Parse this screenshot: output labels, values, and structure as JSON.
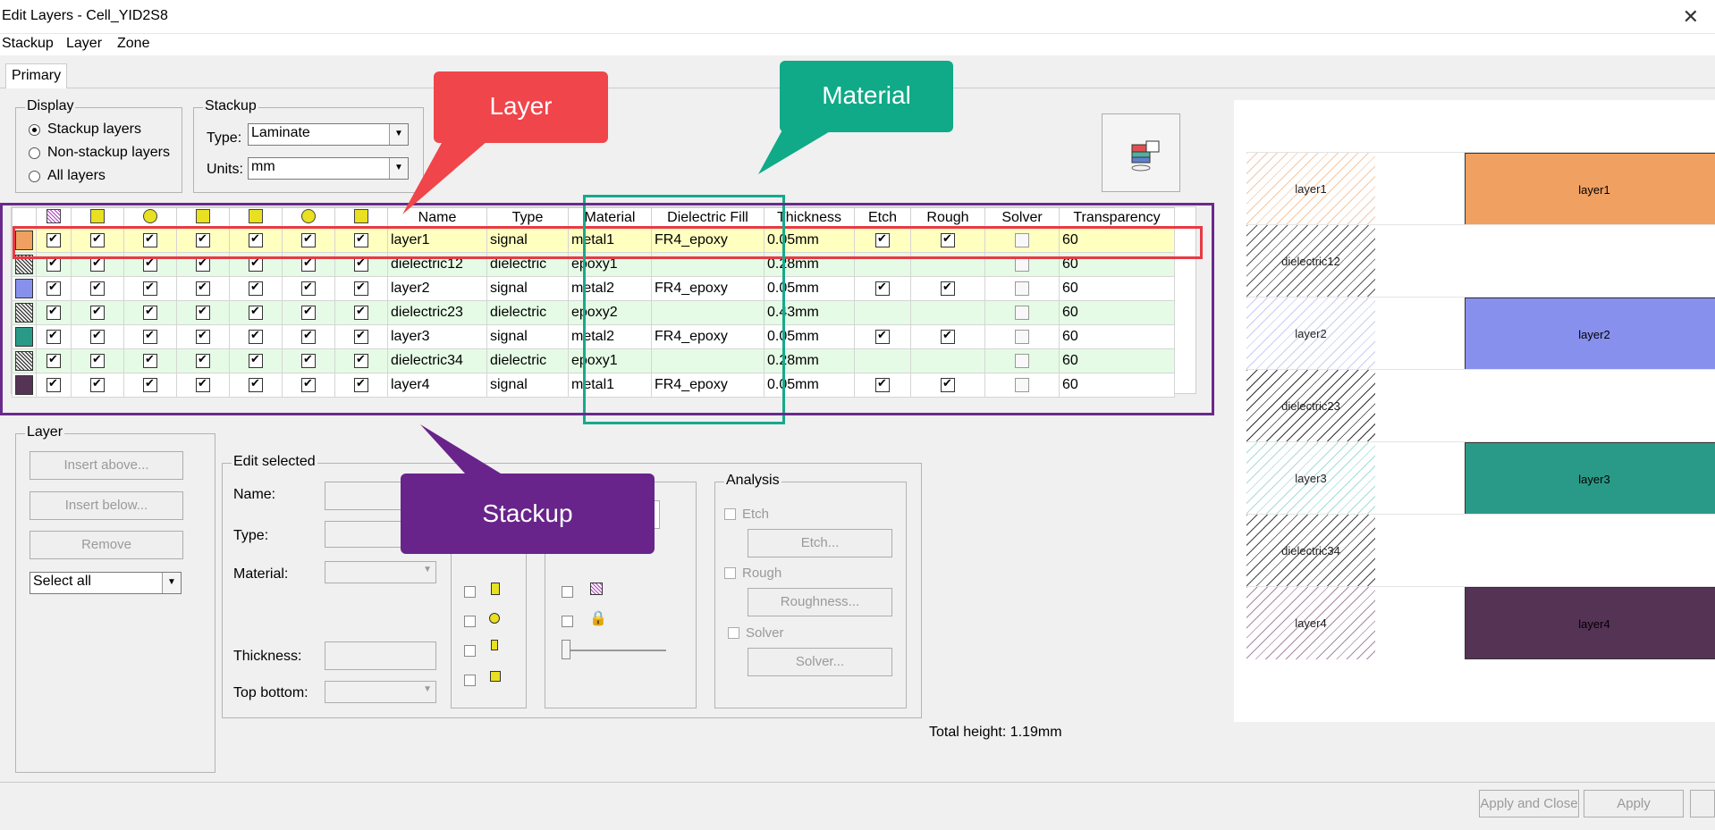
{
  "window": {
    "title": "Edit Layers - Cell_YID2S8",
    "close_icon": "close-icon"
  },
  "menu": [
    "Stackup",
    "Layer",
    "Zone"
  ],
  "tabs": [
    {
      "label": "Primary"
    }
  ],
  "display": {
    "legend": "Display",
    "options": [
      "Stackup layers",
      "Non-stackup layers",
      "All layers"
    ],
    "selected": "Stackup layers"
  },
  "stackup_group": {
    "legend": "Stackup",
    "type_label": "Type:",
    "type_value": "Laminate",
    "units_label": "Units:",
    "units_value": "mm"
  },
  "grid": {
    "columns": [
      "Name",
      "Type",
      "Material",
      "Dielectric Fill",
      "Thickness",
      "Etch",
      "Rough",
      "Solver",
      "Transparency"
    ],
    "icon_columns": [
      "layer-pattern-icon",
      "via-icon",
      "trace-icon",
      "component-icon",
      "pad-icon",
      "connector-icon",
      "antenna-icon"
    ],
    "rows": [
      {
        "name": "layer1",
        "type": "signal",
        "material": "metal1",
        "fill": "FR4_epoxy",
        "thickness": "0.05mm",
        "etch": true,
        "rough": true,
        "solver": false,
        "transparency": "60",
        "color": "#f0a060",
        "hatch": false
      },
      {
        "name": "dielectric12",
        "type": "dielectric",
        "material": "epoxy1",
        "fill": "",
        "thickness": "0.28mm",
        "etch": null,
        "rough": null,
        "solver": false,
        "transparency": "60",
        "color": "#7a8a70",
        "hatch": true
      },
      {
        "name": "layer2",
        "type": "signal",
        "material": "metal2",
        "fill": "FR4_epoxy",
        "thickness": "0.05mm",
        "etch": true,
        "rough": true,
        "solver": false,
        "transparency": "60",
        "color": "#8890ee",
        "hatch": false
      },
      {
        "name": "dielectric23",
        "type": "dielectric",
        "material": "epoxy2",
        "fill": "",
        "thickness": "0.43mm",
        "etch": null,
        "rough": null,
        "solver": false,
        "transparency": "60",
        "color": "#333333",
        "hatch": true
      },
      {
        "name": "layer3",
        "type": "signal",
        "material": "metal2",
        "fill": "FR4_epoxy",
        "thickness": "0.05mm",
        "etch": true,
        "rough": true,
        "solver": false,
        "transparency": "60",
        "color": "#2a9a88",
        "hatch": false
      },
      {
        "name": "dielectric34",
        "type": "dielectric",
        "material": "epoxy1",
        "fill": "",
        "thickness": "0.28mm",
        "etch": null,
        "rough": null,
        "solver": false,
        "transparency": "60",
        "color": "#6a9070",
        "hatch": true
      },
      {
        "name": "layer4",
        "type": "signal",
        "material": "metal1",
        "fill": "FR4_epoxy",
        "thickness": "0.05mm",
        "etch": true,
        "rough": true,
        "solver": false,
        "transparency": "60",
        "color": "#553355",
        "hatch": false
      }
    ]
  },
  "layer_group": {
    "legend": "Layer",
    "insert_above": "Insert above...",
    "insert_below": "Insert below...",
    "remove": "Remove",
    "select": "Select all"
  },
  "edit_selected": {
    "legend": "Edit selected",
    "name_label": "Name:",
    "type_label": "Type:",
    "material_label": "Material:",
    "thickness_label": "Thickness:",
    "topbottom_label": "Top bottom:"
  },
  "analysis": {
    "legend": "Analysis",
    "etch": "Etch",
    "etch_btn": "Etch...",
    "rough": "Rough",
    "rough_btn": "Roughness...",
    "solver": "Solver",
    "solver_btn": "Solver..."
  },
  "total_height": "Total height: 1.19mm",
  "footer": {
    "apply_close": "Apply and Close",
    "apply": "Apply"
  },
  "preview": {
    "rows": [
      {
        "label": "layer1",
        "bar": true,
        "color": "#f0a060",
        "hatch_color": "#f3c8a8"
      },
      {
        "label": "dielectric12",
        "bar": false,
        "hatch_color": "#555555"
      },
      {
        "label": "layer2",
        "bar": true,
        "color": "#8890ee",
        "hatch_color": "#c8ccf4"
      },
      {
        "label": "dielectric23",
        "bar": false,
        "hatch_color": "#333333"
      },
      {
        "label": "layer3",
        "bar": true,
        "color": "#2a9a88",
        "hatch_color": "#a8dcd4"
      },
      {
        "label": "dielectric34",
        "bar": false,
        "hatch_color": "#444444"
      },
      {
        "label": "layer4",
        "bar": true,
        "color": "#553355",
        "hatch_color": "#a888a8"
      }
    ]
  },
  "callouts": {
    "layer": {
      "text": "Layer",
      "color": "#f0454a"
    },
    "material": {
      "text": "Material",
      "color": "#10aa88"
    },
    "stackup": {
      "text": "Stackup",
      "color": "#68248a"
    }
  }
}
